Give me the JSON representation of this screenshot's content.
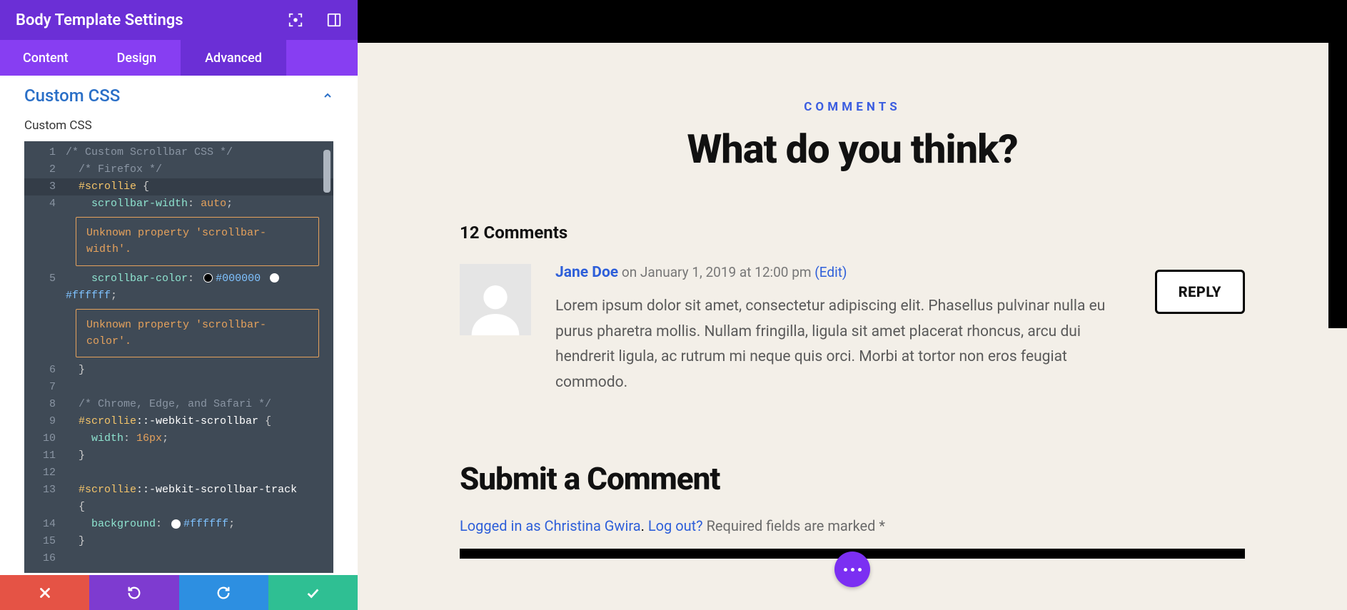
{
  "sidebar": {
    "title": "Body Template Settings",
    "tabs": {
      "content": "Content",
      "design": "Design",
      "advanced": "Advanced"
    },
    "section_title": "Custom CSS",
    "section_sub": "Custom CSS",
    "footer_icons": {
      "close": "close",
      "undo": "undo",
      "redo": "redo",
      "save": "check"
    }
  },
  "code": {
    "l1": "/* Custom Scrollbar CSS */",
    "l2": "/* Firefox */",
    "l3_sel": "#scrollie",
    "l3_brace": " {",
    "l4_prop": "scrollbar-width",
    "l4_val": "auto",
    "lint1": "Unknown property 'scrollbar-width'.",
    "l5_prop": "scrollbar-color",
    "l5_c1": "#000000",
    "l5_c2": "#ffffff",
    "lint2": "Unknown property 'scrollbar-color'.",
    "l8": "/* Chrome, Edge, and Safari */",
    "l9_sel": "#scrollie",
    "l9_pseudo": "::-webkit-scrollbar",
    "l9_brace": " {",
    "l10_prop": "width",
    "l10_val": "16px",
    "l13_sel": "#scrollie",
    "l13_pseudo": "::-webkit-scrollbar-track",
    "l13_brace": " {",
    "l14_prop": "background",
    "l14_val": "#ffffff"
  },
  "preview": {
    "tag": "COMMENTS",
    "heading": "What do you think?",
    "count": "12 Comments",
    "comment": {
      "author": "Jane Doe",
      "on": "on January 1, 2019 at 12:00 pm",
      "edit": "(Edit)",
      "text": "Lorem ipsum dolor sit amet, consectetur adipiscing elit. Phasellus pulvinar nulla eu purus pharetra mollis. Nullam fringilla, ligula sit amet placerat rhoncus, arcu dui hendrerit ligula, ac rutrum mi neque quis orci. Morbi at tortor non eros feugiat commodo.",
      "reply": "REPLY"
    },
    "form": {
      "heading": "Submit a Comment",
      "logged_in": "Logged in as Christina Gwira",
      "logout": "Log out?",
      "note": " Required fields are marked *"
    }
  }
}
